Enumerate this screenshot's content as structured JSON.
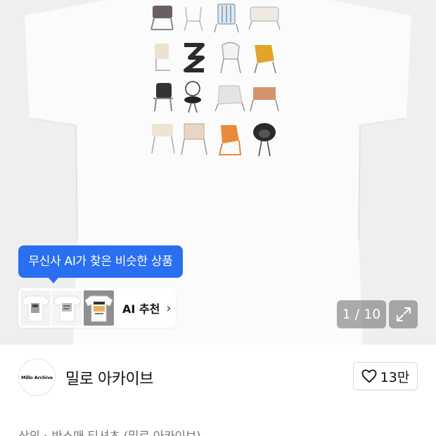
{
  "ai_recommend": {
    "tooltip": "무신사 AI가 찾은 비슷한 상품",
    "label": "AI 추천",
    "chevron": "›",
    "thumbnails": [
      "tshirt-thumb-1",
      "tshirt-thumb-2",
      "tshirt-thumb-3"
    ]
  },
  "gallery": {
    "counter": "1 / 10",
    "expand_icon": "expand-icon",
    "current_index": 1,
    "total": 10
  },
  "brand": {
    "logo_text": "Millo Archive",
    "name": "밀로 아카이브"
  },
  "like": {
    "icon": "heart-icon",
    "count": "13만"
  },
  "breadcrumb": {
    "text": "상의 › 반소매 티셔츠 (밀로 아카이브)"
  },
  "colors": {
    "accent": "#2a6ff2",
    "hero_bg": "#efefef",
    "overlay": "#787878"
  }
}
